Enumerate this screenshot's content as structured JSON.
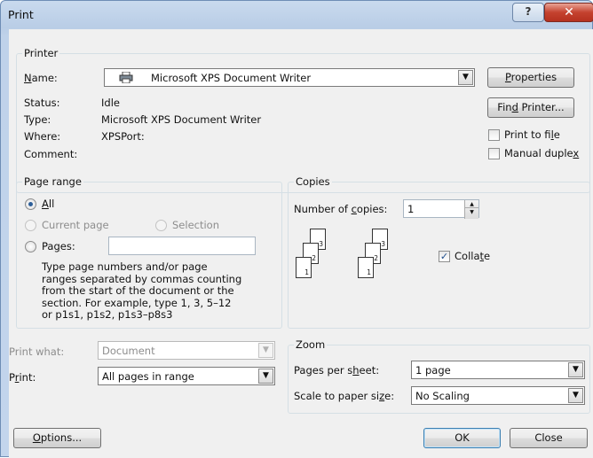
{
  "window": {
    "title": "Print",
    "help_glyph": "?",
    "close_glyph": "✕"
  },
  "printer": {
    "group_label": "Printer",
    "name_label": "Name:",
    "name_value": "Microsoft XPS Document Writer",
    "status_label": "Status:",
    "status_value": "Idle",
    "type_label": "Type:",
    "type_value": "Microsoft XPS Document Writer",
    "where_label": "Where:",
    "where_value": "XPSPort:",
    "comment_label": "Comment:",
    "comment_value": "",
    "properties_button": "Properties",
    "find_printer_button": "Find Printer...",
    "print_to_file_label": "Print to file",
    "print_to_file_checked": false,
    "manual_duplex_label": "Manual duplex",
    "manual_duplex_checked": false
  },
  "page_range": {
    "group_label": "Page range",
    "all_label": "All",
    "current_page_label": "Current page",
    "selection_label": "Selection",
    "pages_label": "Pages:",
    "pages_value": "",
    "selected": "All",
    "help_lines": [
      "Type page numbers and/or page",
      "ranges separated by commas counting",
      "from the start of the document or the",
      "section. For example, type 1, 3, 5–12",
      "or p1s1, p1s2, p1s3–p8s3"
    ]
  },
  "copies": {
    "group_label": "Copies",
    "number_label": "Number of copies:",
    "number_value": "1",
    "collate_label": "Collate",
    "collate_checked": true,
    "page_numbers": [
      "1",
      "2",
      "3"
    ]
  },
  "print_what": {
    "label": "Print what:",
    "value": "Document"
  },
  "print": {
    "label": "Print:",
    "value": "All pages in range"
  },
  "zoom": {
    "group_label": "Zoom",
    "pages_per_sheet_label": "Pages per sheet:",
    "pages_per_sheet_value": "1 page",
    "scale_label": "Scale to paper size:",
    "scale_value": "No Scaling"
  },
  "footer": {
    "options_button": "Options...",
    "ok_button": "OK",
    "close_button": "Close"
  },
  "icons": {
    "printer": "printer-icon",
    "dropdown": "chevron-down-icon",
    "spin_up": "▲",
    "spin_down": "▼",
    "check": "✓"
  }
}
